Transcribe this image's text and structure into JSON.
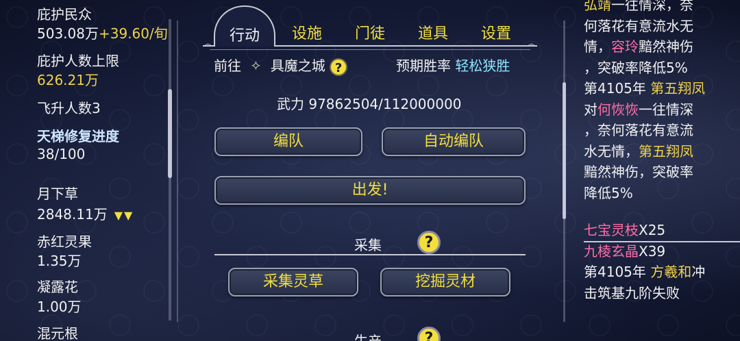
{
  "left": {
    "protect_label": "庇护民众",
    "protect_value": "503.08万",
    "protect_rate": "+39.60/旬",
    "limit_label": "庇护人数上限",
    "limit_value": "626.21万",
    "ascend_label": "飞升人数3",
    "ladder_label": "天梯修复进度",
    "ladder_value": "38/100",
    "items": [
      {
        "name": "月下草",
        "value": "2848.11万",
        "arrows": "▼▼"
      },
      {
        "name": "赤红灵果",
        "value": "1.35万"
      },
      {
        "name": "凝露花",
        "value": "1.00万"
      },
      {
        "name": "混元根",
        "value": ""
      }
    ]
  },
  "tabs": {
    "active": "行动",
    "others": [
      "设施",
      "门徒",
      "道具",
      "设置"
    ]
  },
  "action": {
    "goto_label": "前往",
    "destination": "具魔之城",
    "help_glyph": "?",
    "win_label": "预期胜率",
    "win_value": "轻松狭胜",
    "force_label": "武力 97862504/112000000",
    "team_button": "编队",
    "auto_team_button": "自动编队",
    "depart_button": "出发!",
    "gather_title": "采集",
    "gather_herb_button": "采集灵草",
    "dig_button": "挖掘灵材",
    "produce_title": "生产"
  },
  "log": {
    "lines": [
      [
        {
          "t": "弘靖",
          "c": "gold"
        },
        {
          "t": "一往情深，奈",
          "c": "white"
        }
      ],
      [
        {
          "t": "何落花有意流水无",
          "c": "white"
        }
      ],
      [
        {
          "t": "情，",
          "c": "white"
        },
        {
          "t": "容玲",
          "c": "pink"
        },
        {
          "t": "黯然神伤",
          "c": "white"
        }
      ],
      [
        {
          "t": "，突破率降低5%",
          "c": "white"
        }
      ],
      [
        {
          "t": "第4105年 ",
          "c": "white"
        },
        {
          "t": "第五翔凤",
          "c": "gold"
        }
      ],
      [
        {
          "t": "对",
          "c": "white"
        },
        {
          "t": "何恢恢",
          "c": "pink"
        },
        {
          "t": "一往情深",
          "c": "white"
        }
      ],
      [
        {
          "t": "，奈何落花有意流",
          "c": "white"
        }
      ],
      [
        {
          "t": "水无情，",
          "c": "white"
        },
        {
          "t": "第五翔凤",
          "c": "gold"
        }
      ],
      [
        {
          "t": "黯然神伤，突破率",
          "c": "white"
        }
      ],
      [
        {
          "t": "降低5%",
          "c": "white"
        }
      ],
      [
        {
          "t": "七宝灵枝",
          "c": "pink"
        },
        {
          "t": "X25",
          "c": "white"
        }
      ],
      [
        {
          "t": "九棱玄晶",
          "c": "pink"
        },
        {
          "t": "X39",
          "c": "white"
        }
      ],
      [
        {
          "t": "第4105年 ",
          "c": "white"
        },
        {
          "t": "方羲和",
          "c": "gold"
        },
        {
          "t": "冲",
          "c": "white"
        }
      ],
      [
        {
          "t": "击筑基九阶失败",
          "c": "white"
        }
      ]
    ]
  },
  "colors": {
    "accent_gold": "#f3df3c",
    "pink": "#ff6ea8",
    "cyan": "#8fe3ff"
  }
}
